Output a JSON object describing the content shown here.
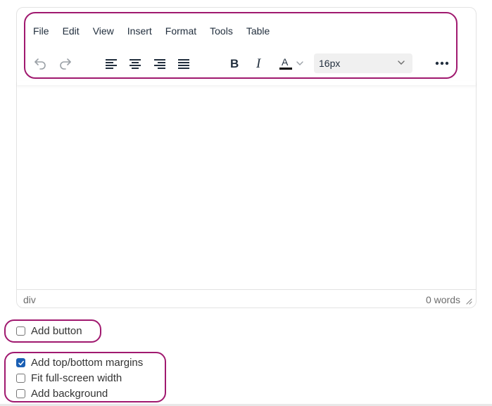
{
  "menubar": {
    "items": [
      "File",
      "Edit",
      "View",
      "Insert",
      "Format",
      "Tools",
      "Table"
    ]
  },
  "toolbar": {
    "font_size": "16px",
    "icons": [
      "undo-icon",
      "redo-icon",
      "align-left-icon",
      "align-center-icon",
      "align-right-icon",
      "align-justify-icon",
      "bold-icon",
      "italic-icon",
      "text-color-icon",
      "chevron-down-icon",
      "more-icon"
    ],
    "text_color_accent": "#000000"
  },
  "statusbar": {
    "path": "div",
    "word_count": "0 words"
  },
  "options": {
    "add_button": {
      "label": "Add button",
      "checked": false
    },
    "add_margins": {
      "label": "Add top/bottom margins",
      "checked": true
    },
    "fit_width": {
      "label": "Fit full-screen width",
      "checked": false
    },
    "add_background": {
      "label": "Add background",
      "checked": false
    }
  },
  "colors": {
    "highlight_border": "#a0196f",
    "checkbox_checked": "#1a5fb4",
    "text": "#222f3e"
  }
}
